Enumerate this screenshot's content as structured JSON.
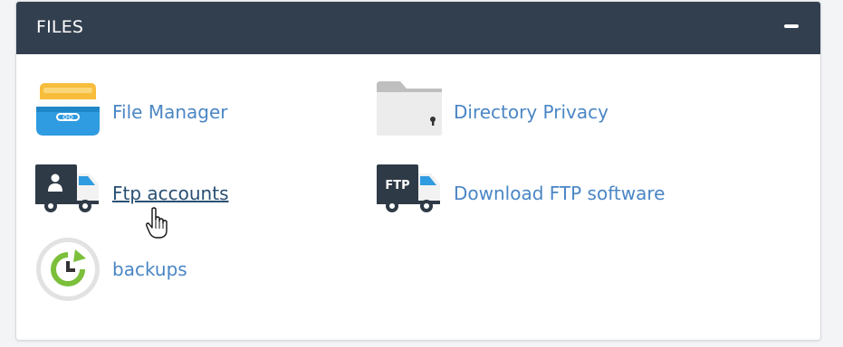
{
  "panel": {
    "title": "FILES",
    "collapse_icon": "minus-icon"
  },
  "items": [
    {
      "label": "File Manager",
      "icon": "file-manager-icon"
    },
    {
      "label": "Directory Privacy",
      "icon": "directory-privacy-icon"
    },
    {
      "label": "Ftp accounts",
      "icon": "ftp-accounts-icon",
      "state": "hover"
    },
    {
      "label": "Download FTP software",
      "icon": "ftp-truck-icon",
      "badge": "FTP"
    },
    {
      "label": "backups",
      "icon": "backups-icon"
    }
  ],
  "colors": {
    "header_bg": "#323f4f",
    "link": "#4a86c5",
    "link_hover": "#2a4f73",
    "folder_yellow": "#f7bd3b",
    "drawer_blue": "#2f9be0",
    "truck_dark": "#2f3a47",
    "backup_green": "#7bbf3a"
  }
}
